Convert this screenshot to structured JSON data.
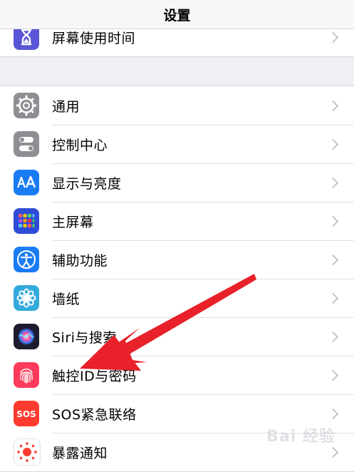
{
  "navbar": {
    "title": "设置"
  },
  "top_group": {
    "items": [
      {
        "label": "屏幕使用时间",
        "icon": "hourglass-icon",
        "color": "#5856d6"
      }
    ]
  },
  "main_group": {
    "items": [
      {
        "label": "通用",
        "icon": "gear-icon",
        "color": "#8e8e93"
      },
      {
        "label": "控制中心",
        "icon": "toggles-icon",
        "color": "#8e8e93"
      },
      {
        "label": "显示与亮度",
        "icon": "text-size-icon",
        "color": "#1a7cf5"
      },
      {
        "label": "主屏幕",
        "icon": "app-grid-icon",
        "color": "#2f4bd8"
      },
      {
        "label": "辅助功能",
        "icon": "accessibility-icon",
        "color": "#1a7cf5"
      },
      {
        "label": "墙纸",
        "icon": "flower-icon",
        "color": "#34aadc"
      },
      {
        "label": "Siri与搜索",
        "icon": "siri-icon",
        "color": "#1c1c2e"
      },
      {
        "label": "触控ID与密码",
        "icon": "fingerprint-icon",
        "color": "#fe3b5b"
      },
      {
        "label": "SOS紧急联络",
        "icon": "sos-icon",
        "color": "#ff3b30"
      },
      {
        "label": "暴露通知",
        "icon": "exposure-icon",
        "color": "#ffffff"
      }
    ]
  },
  "annotation": {
    "arrow_color": "#e8212a"
  },
  "watermark": {
    "text": "Bai 经验"
  }
}
